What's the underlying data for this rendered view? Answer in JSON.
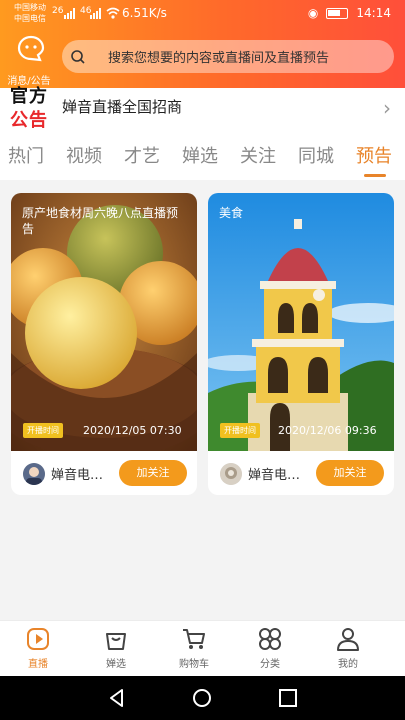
{
  "status_bar": {
    "carrier_1": "中国移动",
    "carrier_2": "中国电信",
    "signal_1": "26",
    "signal_2": "46",
    "net_speed": "6.51K/s",
    "time": "14:14"
  },
  "header": {
    "message_label": "消息/公告",
    "search_placeholder": "搜索您想要的内容或直播间及直播预告"
  },
  "notice": {
    "logo_line_1": "官方",
    "logo_line_2": "公告",
    "text": "婵音直播全国招商"
  },
  "tabs": [
    {
      "label": "热门",
      "active": false
    },
    {
      "label": "视频",
      "active": false
    },
    {
      "label": "才艺",
      "active": false
    },
    {
      "label": "婵选",
      "active": false
    },
    {
      "label": "关注",
      "active": false
    },
    {
      "label": "同城",
      "active": false
    },
    {
      "label": "预告",
      "active": true
    }
  ],
  "cards": [
    {
      "title": "原产地食材周六晚八点直播预告",
      "tag": "开播时间",
      "time": "2020/12/05 07:30",
      "anchor": "婵音电…",
      "button": "加关注"
    },
    {
      "title": "美食",
      "tag": "开播时间",
      "time": "2020/12/06 09:36",
      "anchor": "婵音电…",
      "button": "加关注"
    }
  ],
  "bottom_nav": [
    {
      "label": "直播",
      "icon": "live-play-icon",
      "active": true
    },
    {
      "label": "婵选",
      "icon": "shopping-bag-icon",
      "active": false
    },
    {
      "label": "购物车",
      "icon": "cart-icon",
      "active": false
    },
    {
      "label": "分类",
      "icon": "category-icon",
      "active": false
    },
    {
      "label": "我的",
      "icon": "user-icon",
      "active": false
    }
  ],
  "colors": {
    "accent": "#e8842a",
    "header_start": "#ff9a1f",
    "header_end": "#ff4f3a",
    "follow_button": "#f39a1c",
    "notice_red": "#e8282b"
  }
}
